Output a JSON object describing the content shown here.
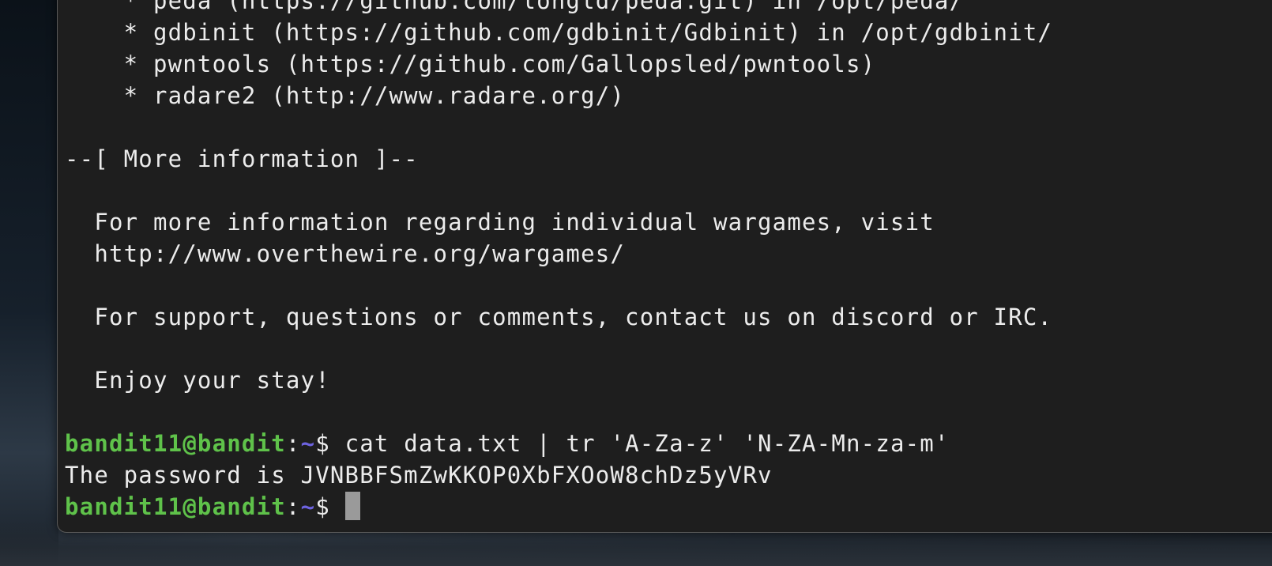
{
  "motd": {
    "tools": [
      "    * peda (https://github.com/longld/peda.git) in /opt/peda/",
      "    * gdbinit (https://github.com/gdbinit/Gdbinit) in /opt/gdbinit/",
      "    * pwntools (https://github.com/Gallopsled/pwntools)",
      "    * radare2 (http://www.radare.org/)"
    ],
    "section_header": "--[ More information ]--",
    "info_line_1": "  For more information regarding individual wargames, visit",
    "info_line_2": "  http://www.overthewire.org/wargames/",
    "support_line": "  For support, questions or comments, contact us on discord or IRC.",
    "farewell": "  Enjoy your stay!"
  },
  "prompt": {
    "user_host": "bandit11@bandit",
    "colon": ":",
    "path": "~",
    "dollar": "$"
  },
  "command": " cat data.txt | tr 'A-Za-z' 'N-ZA-Mn-za-m'",
  "output": "The password is JVNBBFSmZwKKOP0XbFXOoW8chDz5yVRv",
  "colors": {
    "terminal_bg": "#1e1e1e",
    "text": "#ececec",
    "prompt_user": "#5fc24a",
    "prompt_path": "#6d63e0",
    "cursor": "#9a9a9a"
  }
}
